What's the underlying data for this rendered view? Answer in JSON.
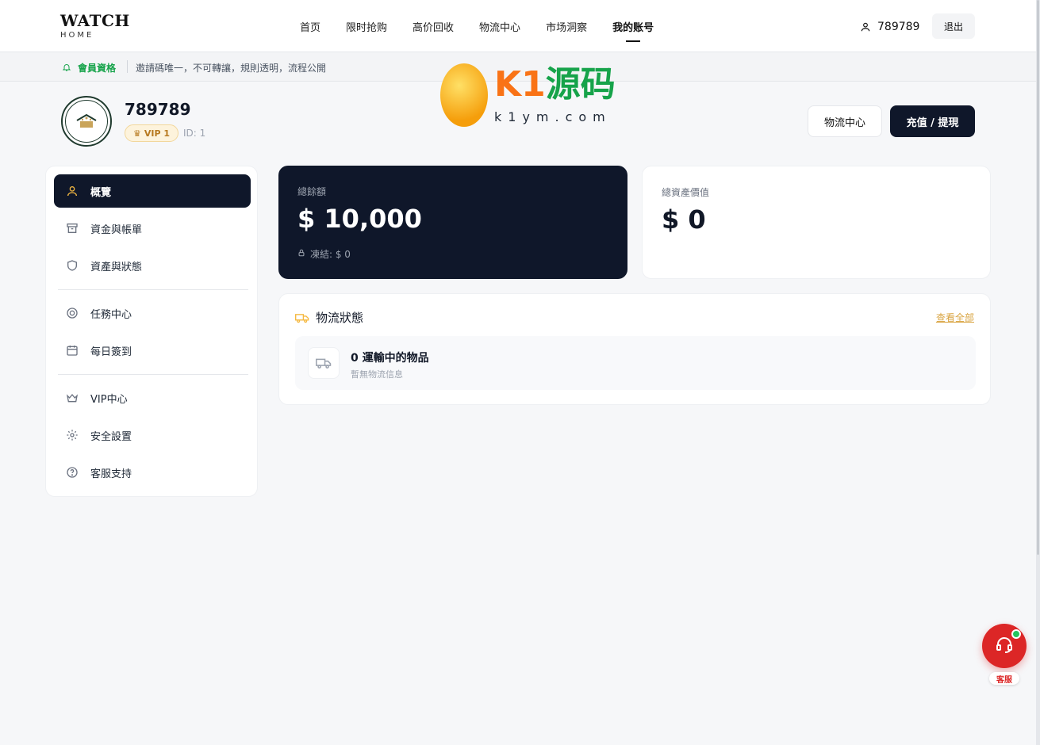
{
  "header": {
    "logo_main": "WATCH",
    "logo_sub": "HOME",
    "nav": [
      "首页",
      "限时抢购",
      "高价回收",
      "物流中心",
      "市场洞察",
      "我的账号"
    ],
    "active_nav": "我的账号",
    "username": "789789",
    "logout": "退出"
  },
  "notice": {
    "label": "會員資格",
    "text": "邀請碼唯一，不可轉讓，規則透明，流程公開"
  },
  "watermark": {
    "brand_k1": "K1",
    "brand_cn": "源码",
    "url": "k1ym.com"
  },
  "profile": {
    "name": "789789",
    "vip": "VIP 1",
    "id_text": "ID: 1",
    "btn_logistics": "物流中心",
    "btn_recharge": "充值 / 提現"
  },
  "sidebar": {
    "items": [
      {
        "label": "概覽",
        "icon": "user-icon"
      },
      {
        "label": "資金與帳單",
        "icon": "archive-icon"
      },
      {
        "label": "資產與狀態",
        "icon": "shield-icon"
      },
      {
        "label": "任務中心",
        "icon": "target-icon"
      },
      {
        "label": "每日簽到",
        "icon": "calendar-icon"
      },
      {
        "label": "VIP中心",
        "icon": "crown-icon"
      },
      {
        "label": "安全設置",
        "icon": "gear-icon"
      },
      {
        "label": "客服支持",
        "icon": "help-icon"
      }
    ]
  },
  "balance": {
    "label": "總餘額",
    "amount": "$ 10,000",
    "frozen": "凍結: $ 0"
  },
  "assets": {
    "label": "總資產價值",
    "amount": "$ 0"
  },
  "logistics": {
    "title": "物流狀態",
    "view_all": "查看全部",
    "count_text": "0 運輸中的物品",
    "sub_text": "暫無物流信息"
  },
  "support": {
    "label": "客服"
  },
  "colors": {
    "dark": "#0f172a",
    "gold": "#d9a441",
    "green": "#16a34a",
    "red": "#dc2626"
  }
}
